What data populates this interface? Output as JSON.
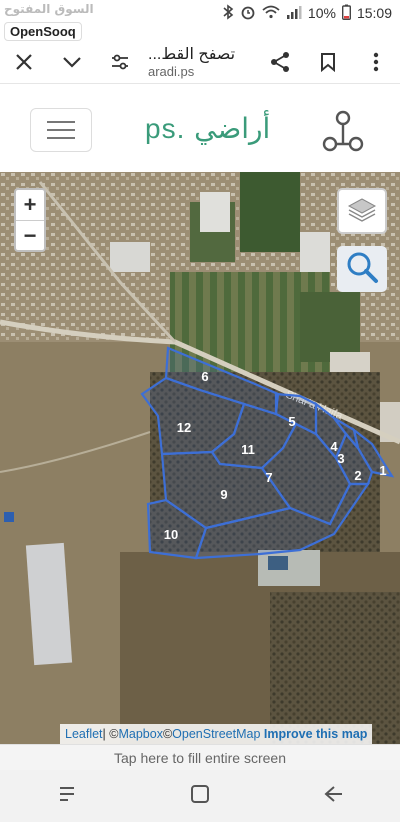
{
  "statusbar": {
    "watermark": "السوق المفتوح",
    "brand": "OpenSooq",
    "battery": "10%",
    "time": "15:09"
  },
  "browser": {
    "title": "تصفح القط...",
    "url": "aradi.ps"
  },
  "site": {
    "logo_ar": "أراضي",
    "logo_latin": "ps."
  },
  "map": {
    "zoom_in": "+",
    "zoom_out": "−",
    "road_label": "Shar'a Haifa",
    "parcels": [
      {
        "label": "1"
      },
      {
        "label": "2"
      },
      {
        "label": "3"
      },
      {
        "label": "4"
      },
      {
        "label": "5"
      },
      {
        "label": "6"
      },
      {
        "label": "7"
      },
      {
        "label": "9"
      },
      {
        "label": "10"
      },
      {
        "label": "11"
      },
      {
        "label": "12"
      }
    ],
    "parcel_color": "#3d6fd6"
  },
  "attribution": {
    "leaflet": "Leaflet",
    "sep": " | © ",
    "mapbox": "Mapbox",
    "copy2": " © ",
    "osm": "OpenStreetMap",
    "improve": "Improve this map"
  },
  "fill_screen": "Tap here to fill entire screen"
}
